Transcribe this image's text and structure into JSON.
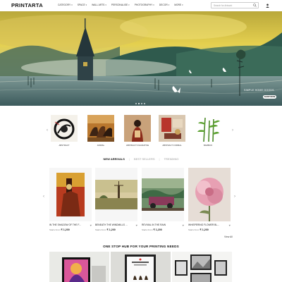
{
  "brand": {
    "logo": "PRINTARTA"
  },
  "nav": [
    {
      "label": "CATEGORY"
    },
    {
      "label": "SPACE"
    },
    {
      "label": "WALL ARTS"
    },
    {
      "label": "PERSONALISE"
    },
    {
      "label": "PHOTOGRAPHY"
    },
    {
      "label": "DECOR"
    },
    {
      "label": "MORE"
    }
  ],
  "search": {
    "placeholder": "Search for Artwork"
  },
  "hero": {
    "caption": "SIMPLE HOME GOODS",
    "button": "SHOP NOW",
    "slides": 4,
    "active_slide": 1
  },
  "categories": [
    {
      "label": "ABSTRACT"
    },
    {
      "label": "ANIMAL"
    },
    {
      "label": "ABSTRACT FIGURATIVE"
    },
    {
      "label": "ABSTRACT FORMAL"
    },
    {
      "label": "BAMBOO"
    }
  ],
  "tabs": [
    {
      "label": "NEW ARRIVALS",
      "active": true
    },
    {
      "label": "BEST SELLERS",
      "active": false
    },
    {
      "label": "TRENDING",
      "active": false
    }
  ],
  "products": [
    {
      "name": "IN THE SHADOW OF THE F...",
      "from": "Starts From",
      "price": "₹ 1,200"
    },
    {
      "name": "BENEATH THE WINDMILLS ...",
      "from": "Starts From",
      "price": "₹ 1,200"
    },
    {
      "name": "REVIVAL IN THE RAIN",
      "from": "Starts From",
      "price": "₹ 1,200"
    },
    {
      "name": "WHISPERING FLOWER BL...",
      "from": "Starts From",
      "price": "₹ 1,200"
    }
  ],
  "view_all": "View All",
  "hub": {
    "title": "ONE STOP HUB FOR YOUR PRINTING NEEDS"
  },
  "colors": {
    "accent": "#111111",
    "muted": "#999999"
  }
}
